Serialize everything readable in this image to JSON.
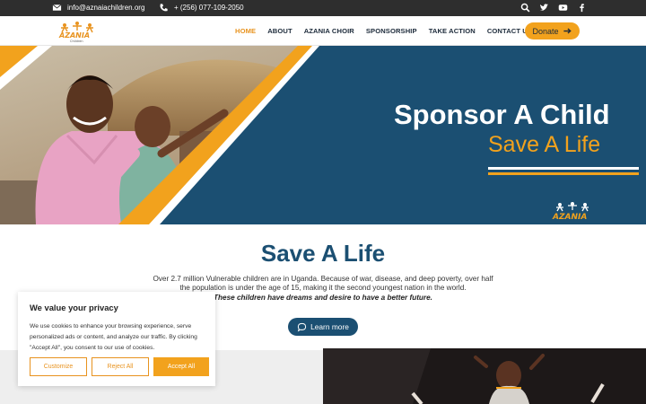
{
  "topbar": {
    "email": "info@aznaiachildren.org",
    "phone": "+ (256) 077-109-2050",
    "social_icons": [
      "search-icon",
      "twitter-icon",
      "youtube-icon",
      "facebook-icon"
    ]
  },
  "nav": {
    "logo": "Azania Children",
    "items": [
      {
        "label": "HOME",
        "active": true
      },
      {
        "label": "ABOUT",
        "active": false
      },
      {
        "label": "AZANIA CHOIR",
        "active": false
      },
      {
        "label": "SPONSORSHIP",
        "active": false
      },
      {
        "label": "TAKE ACTION",
        "active": false
      },
      {
        "label": "CONTACT US",
        "active": false
      }
    ],
    "donate_label": "Donate",
    "donate_icon": "arrow-right-icon"
  },
  "hero": {
    "title": "Sponsor A Child",
    "subtitle": "Save A Life",
    "logo_text": "AZANIA"
  },
  "content": {
    "title": "Save A Life",
    "paragraph": "Over 2.7 million Vulnerable children are in Uganda. Because of war, disease, and deep poverty, over half the population is under the age of 15, making it the second youngest nation in the world.",
    "emphasis": "These children have dreams and desire to have a better future.",
    "learn_more_label": "Learn more",
    "learn_more_icon": "chat-icon"
  },
  "cookie": {
    "title": "We value your privacy",
    "text": "We use cookies to enhance your browsing experience, serve personalized ads or content, and analyze our traffic. By clicking \"Accept All\", you consent to our use of cookies.",
    "customize": "Customize",
    "reject": "Reject All",
    "accept": "Accept All"
  },
  "colors": {
    "navy": "#1b4f72",
    "orange": "#f2a21d",
    "dark": "#2e2e2e"
  }
}
